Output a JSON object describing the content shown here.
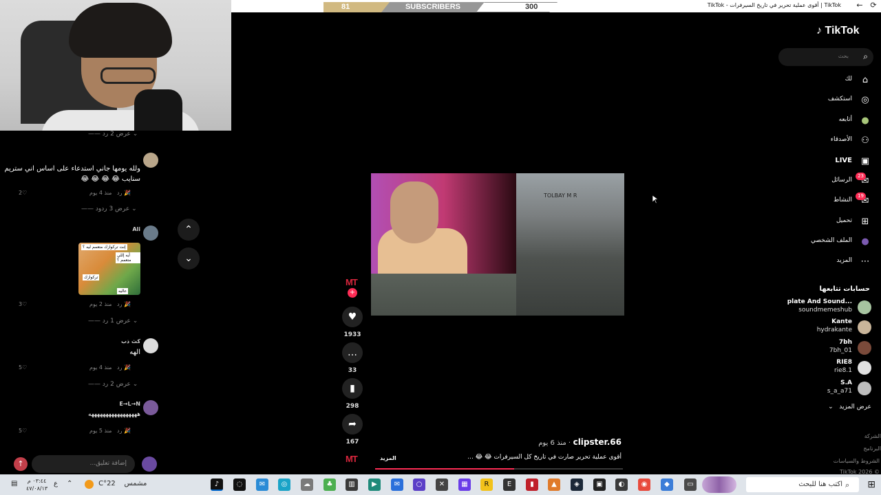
{
  "browser": {
    "tab_title": "TikTok | أقوى عملية تحرير في تاريخ السيرفرات - TikTok",
    "back_icon": "←",
    "refresh_icon": "⟳"
  },
  "subscribers_bar": {
    "current": "81",
    "label": "SUBSCRIBERS",
    "goal": "300",
    "progress_fraction": 0.27
  },
  "comments": {
    "items": [
      {
        "replies": "عرض 2 رد"
      },
      {
        "name": "",
        "text": "ولله يومها جاني استدعاء على اساس اني ستريم سنايب 😂 😂 😂 😂",
        "time": "منذ 4 يوم",
        "reply": "رد",
        "likes": "2",
        "replies": "عرض 3 ردود"
      },
      {
        "name": "Ali",
        "image_text_1": "إنت تركوازك متعمم ليه ؟",
        "image_text_2": "أيه إللي متعمم ؟",
        "image_text_3": "تركوازك",
        "image_text_4": "عاليه",
        "time": "منذ 2 يوم",
        "reply": "رد",
        "likes": "3",
        "replies": "عرض 1 رد"
      },
      {
        "name": "كث ذب",
        "text": "الهه",
        "time": "منذ 4 يوم",
        "reply": "رد",
        "likes": "5",
        "replies": "عرض 2 رد"
      },
      {
        "name": "E→L→N",
        "text": "هههههههههههههههههه",
        "time": "منذ 5 يوم",
        "reply": "رد",
        "likes": "5"
      }
    ],
    "input_placeholder": "إضافة تعليق...",
    "at_icon": "@",
    "emoji_icon": "☺",
    "post_icon": "↑"
  },
  "player": {
    "nav_up": "⌃",
    "nav_down": "⌄",
    "sign_text": "TOLBAY M R",
    "author": "clipster.66",
    "time": "· منذ 6 يوم",
    "description": "أقوى عملية تحرير صارت في تاريخ كل السيرفرات 😂 😂 ...",
    "more": "المزيد",
    "progress_fraction": 0.56,
    "likes": "1933",
    "comments": "33",
    "saves": "298",
    "shares": "167",
    "mt_logo": "MT",
    "follow_plus": "+"
  },
  "sidebar": {
    "logo": "TikTok",
    "search_placeholder": "بحث",
    "nav": [
      {
        "label": "لك",
        "icon": "⌂"
      },
      {
        "label": "استكشف",
        "icon": "◎"
      },
      {
        "label": "أتابعه",
        "icon": "●"
      },
      {
        "label": "الأصدقاء",
        "icon": "⚇"
      },
      {
        "label": "LIVE",
        "icon": "▣"
      },
      {
        "label": "الرسائل",
        "icon": "✉",
        "badge": "23"
      },
      {
        "label": "النشاط",
        "icon": "✉",
        "badge": "19"
      },
      {
        "label": "تحميل",
        "icon": "⊞"
      },
      {
        "label": "الملف الشخصي",
        "icon": "●"
      },
      {
        "label": "المزيد",
        "icon": "⋯"
      }
    ],
    "following_title": "حسابات تتابعها",
    "following": [
      {
        "name": "plate And Sound...",
        "handle": "soundmemeshub",
        "color": "#a7c4a0"
      },
      {
        "name": "Kante",
        "handle": "hydrakante",
        "color": "#c9b59a"
      },
      {
        "name": "7bh",
        "handle": "7bh_01",
        "color": "#7a4a3a"
      },
      {
        "name": "RIE8",
        "handle": "rie8.1",
        "color": "#e0e0e0"
      },
      {
        "name": "S.A",
        "handle": "s_a_a71",
        "color": "#bdbdbd"
      }
    ],
    "show_more": "عرض المزيد",
    "footer": [
      "الشركة",
      "البرنامج",
      "الشروط والسياسات",
      "© 2026 TikTok"
    ]
  },
  "taskbar": {
    "search_placeholder": "اكتب هنا للبحث",
    "weather_temp": "22°C",
    "weather_text": "مشمس",
    "time": "٠٣:٤٤ م",
    "date": "٤٧/٠٨/١٣",
    "lang": "ع",
    "start_icon": "⊞",
    "search_icon": "⌕"
  }
}
